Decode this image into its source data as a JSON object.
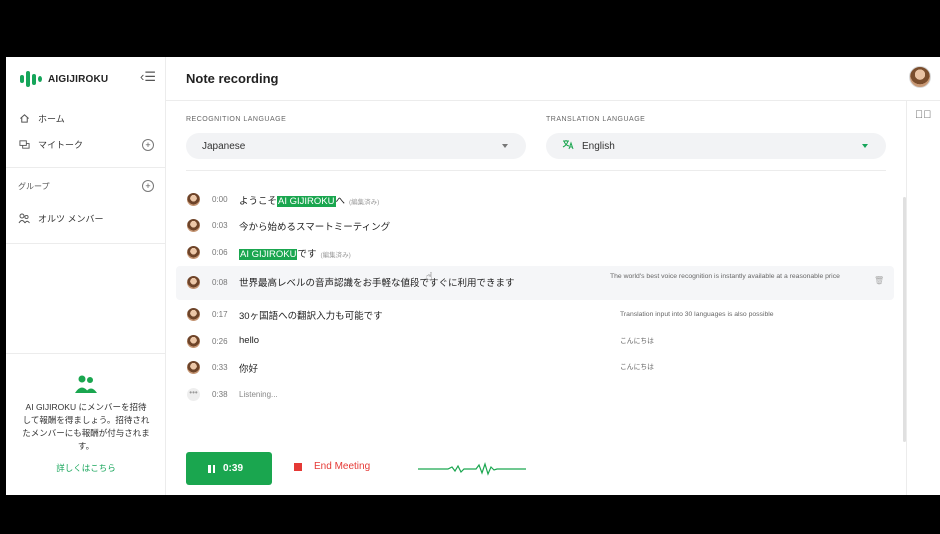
{
  "app": {
    "brand": "AIGIJIROKU"
  },
  "colors": {
    "accent": "#1aa64f",
    "danger": "#e53935"
  },
  "sidebar": {
    "collapse_icon": "collapse-menu-icon",
    "nav": [
      {
        "label": "ホーム",
        "icon": "home-icon"
      },
      {
        "label": "マイトーク",
        "icon": "chat-icon"
      }
    ],
    "group_label": "グループ",
    "group_items": [
      {
        "label": "オルツ メンバー",
        "icon": "members-icon"
      }
    ],
    "invite": {
      "text": "AI GIJIROKU にメンバーを招待して報酬を得ましょう。招待されたメンバーにも報酬が付与されます。",
      "link": "詳しくはこちら"
    }
  },
  "main": {
    "title": "Note recording",
    "recognition": {
      "label": "RECOGNITION LANGUAGE",
      "value": "Japanese"
    },
    "translation": {
      "label": "TRANSLATION LANGUAGE",
      "value": "English"
    },
    "edited_tag": "(編集済み)",
    "transcript": [
      {
        "time": "0:00",
        "pre": "ようこそ",
        "mark": "AI GIJIROKU",
        "post": "へ",
        "edited": true,
        "translation": ""
      },
      {
        "time": "0:03",
        "pre": "今から始めるスマートミーティング",
        "mark": "",
        "post": "",
        "edited": false,
        "translation": ""
      },
      {
        "time": "0:06",
        "pre": "",
        "mark": "AI GIJIROKU",
        "post": "です",
        "edited": true,
        "translation": ""
      },
      {
        "time": "0:08",
        "pre": "世界最高レベルの音声認識をお手軽な値段ですぐに利用できます",
        "mark": "",
        "post": "",
        "edited": false,
        "translation": "The world's best voice recognition is instantly available at a reasonable price"
      },
      {
        "time": "0:17",
        "pre": "30ヶ国語への翻訳入力も可能です",
        "mark": "",
        "post": "",
        "edited": false,
        "translation": "Translation input into 30 languages is also possible"
      },
      {
        "time": "0:26",
        "pre": "hello",
        "mark": "",
        "post": "",
        "edited": false,
        "translation": "こんにちは"
      },
      {
        "time": "0:33",
        "pre": "你好",
        "mark": "",
        "post": "",
        "edited": false,
        "translation": "こんにちは"
      }
    ],
    "listening": {
      "time": "0:38",
      "text": "Listening..."
    },
    "controls": {
      "timer": "0:39",
      "end_label": "End Meeting"
    }
  }
}
